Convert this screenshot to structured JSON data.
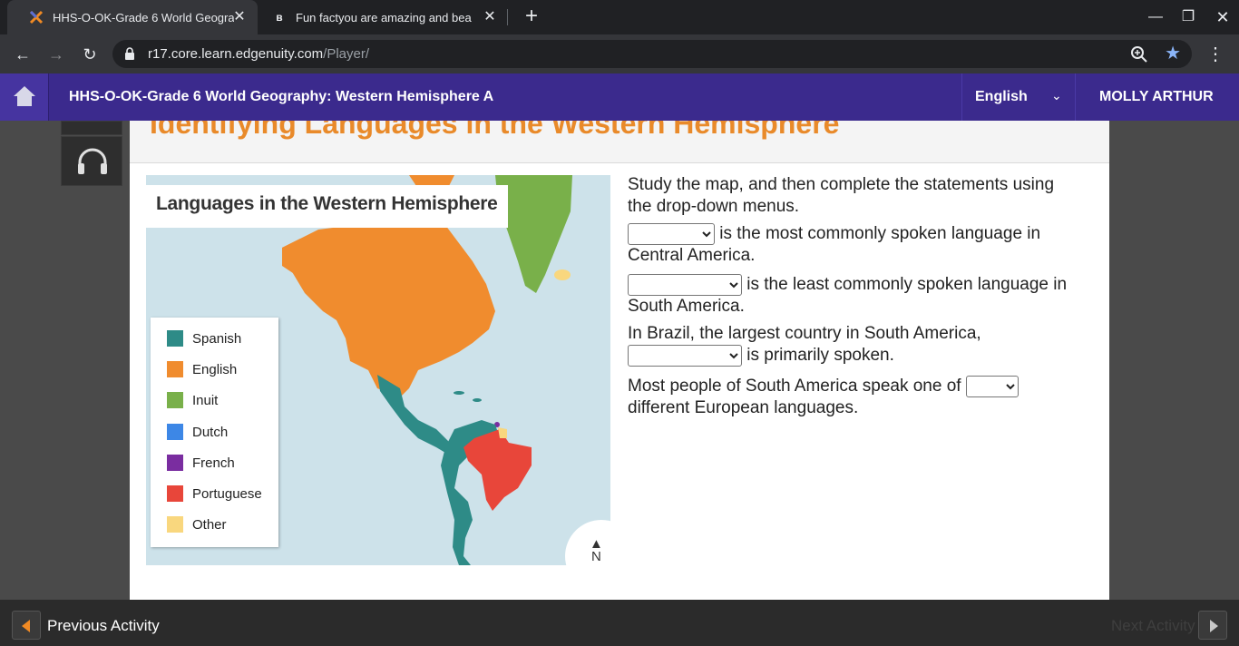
{
  "browser": {
    "tabs": [
      {
        "title": "HHS-O-OK-Grade 6 World Geogra",
        "active": true,
        "favicon": "edgenuity-x-icon"
      },
      {
        "title": "Fun factyou are amazing and bea",
        "active": false,
        "favicon": "brainly-b-icon"
      }
    ],
    "url_host": "r17.core.learn.edgenuity.com",
    "url_path": "/Player/",
    "bookmarked": true
  },
  "app": {
    "course_title": "HHS-O-OK-Grade 6 World Geography: Western Hemisphere A",
    "language": "English",
    "user_name": "MOLLY ARTHUR"
  },
  "lesson": {
    "heading": "Identifying Languages in the Western Hemisphere"
  },
  "map": {
    "title": "Languages in the Western Hemisphere",
    "legend": [
      {
        "label": "Spanish",
        "color": "#2e8b87"
      },
      {
        "label": "English",
        "color": "#f08c2e"
      },
      {
        "label": "Inuit",
        "color": "#79b04a"
      },
      {
        "label": "Dutch",
        "color": "#3d87e6"
      },
      {
        "label": "French",
        "color": "#7a2da0"
      },
      {
        "label": "Portuguese",
        "color": "#e8463a"
      },
      {
        "label": "Other",
        "color": "#f9d77e"
      }
    ],
    "compass_label": "N"
  },
  "questions": {
    "instructions": "Study the map, and then complete the statements using the drop-down menus.",
    "q1_after": " is the most commonly spoken language in Central America.",
    "q2_after": " is the least commonly spoken language in South America.",
    "q3_before": "In Brazil, the largest country in South America,",
    "q3_after": " is primarily spoken.",
    "q4_before": "Most people of South America speak one of ",
    "q4_after": "different European languages."
  },
  "footer": {
    "prev_label": "Previous Activity",
    "next_label": "Next Activity"
  }
}
